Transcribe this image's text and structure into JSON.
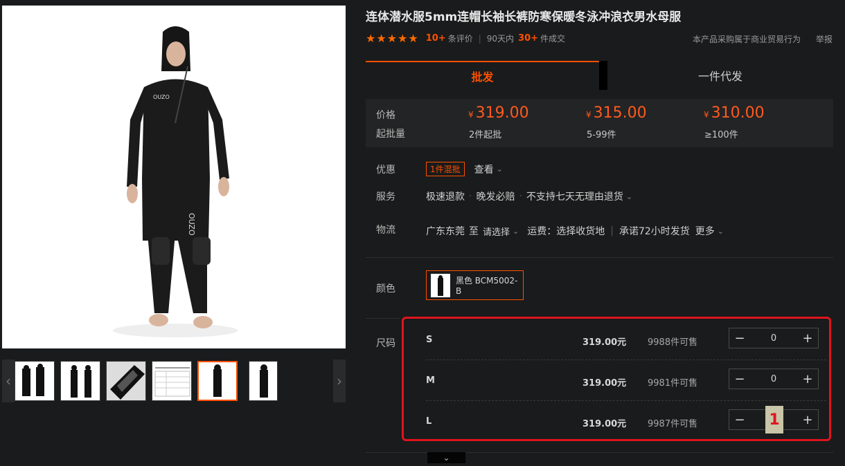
{
  "product": {
    "title": "连体潜水服5mm连帽长袖长裤防寒保暖冬泳冲浪衣男水母服",
    "rating_stars": "★★★★★",
    "review_count": "10+",
    "review_label": "条评价",
    "period": "90天内",
    "sold_count": "30+",
    "sold_label": "件成交",
    "trade_note": "本产品采购属于商业贸易行为",
    "report": "举报",
    "brand_mark": "OUZO"
  },
  "tabs": [
    {
      "label": "批发"
    },
    {
      "label": "一件代发"
    }
  ],
  "price": {
    "price_label": "价格",
    "qty_label": "起批量",
    "currency": "¥",
    "tiers": [
      {
        "price": "319.00",
        "qty": "2件起批"
      },
      {
        "price": "315.00",
        "qty": "5-99件"
      },
      {
        "price": "310.00",
        "qty": "≥100件"
      }
    ]
  },
  "promo": {
    "label": "优惠",
    "tag": "1件混批",
    "view": "查看"
  },
  "service": {
    "label": "服务",
    "items": [
      "极速退款",
      "晚发必赔",
      "不支持七天无理由退货"
    ]
  },
  "logistics": {
    "label": "物流",
    "origin": "广东东莞",
    "to": "至",
    "select": "请选择",
    "fee": "运费：选择收货地",
    "ship": "承诺72小时发货",
    "more": "更多"
  },
  "color": {
    "label": "颜色",
    "option": "黑色 BCM5002-B"
  },
  "size": {
    "label": "尺码",
    "rows": [
      {
        "name": "S",
        "price": "319.00元",
        "stock": "9988件可售",
        "qty": "0"
      },
      {
        "name": "M",
        "price": "319.00元",
        "stock": "9981件可售",
        "qty": "0"
      },
      {
        "name": "L",
        "price": "319.00元",
        "stock": "9987件可售",
        "qty": "1"
      }
    ],
    "minus": "−",
    "plus": "+"
  },
  "icons": {
    "prev": "‹",
    "next": "›",
    "chevron_down": "⌄"
  }
}
